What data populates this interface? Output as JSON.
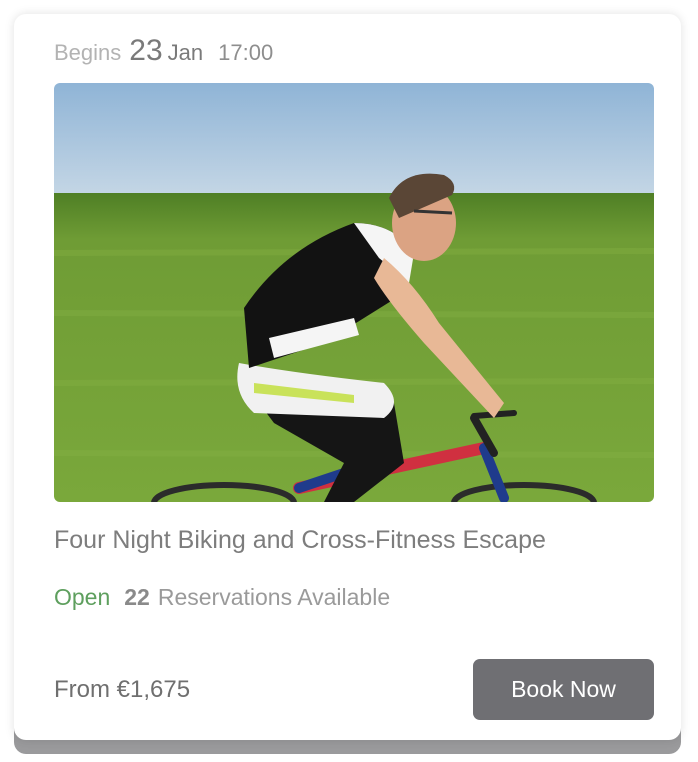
{
  "event": {
    "begins_label": "Begins",
    "day": "23",
    "month": "Jan",
    "time": "17:00",
    "title": "Four Night Biking and Cross-Fitness Escape",
    "status": "Open",
    "reservations_count": "22",
    "reservations_label": "Reservations Available",
    "price": "From €1,675",
    "book_label": "Book Now",
    "image_subject": "cyclist-photo"
  },
  "colors": {
    "status_open": "#5e9f5e",
    "button_bg": "#6f6f73",
    "card_bg": "#ffffff"
  }
}
